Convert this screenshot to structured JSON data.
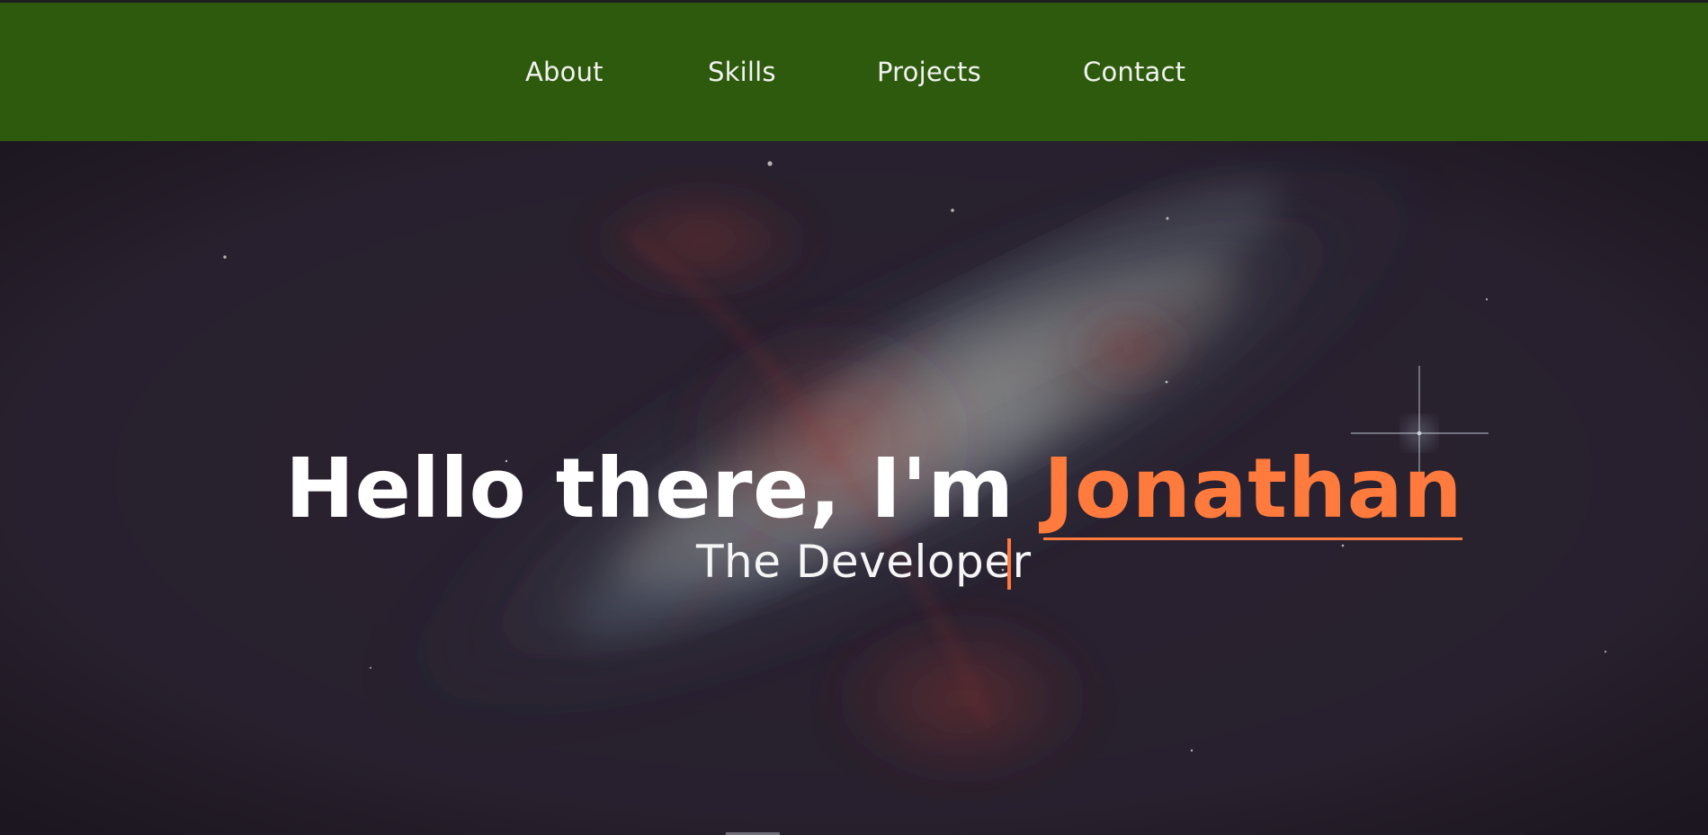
{
  "nav": {
    "items": [
      {
        "label": "About"
      },
      {
        "label": "Skills"
      },
      {
        "label": "Projects"
      },
      {
        "label": "Contact"
      }
    ],
    "background_color": "#2d5a0c",
    "text_color": "#f2f2f2"
  },
  "hero": {
    "headline_prefix": "Hello there, I'm ",
    "headline_name": "Jonathan",
    "subtitle": "The Developer",
    "accent_color": "#ff7a3d",
    "text_color": "#ffffff",
    "background_image": "galaxy-background"
  }
}
